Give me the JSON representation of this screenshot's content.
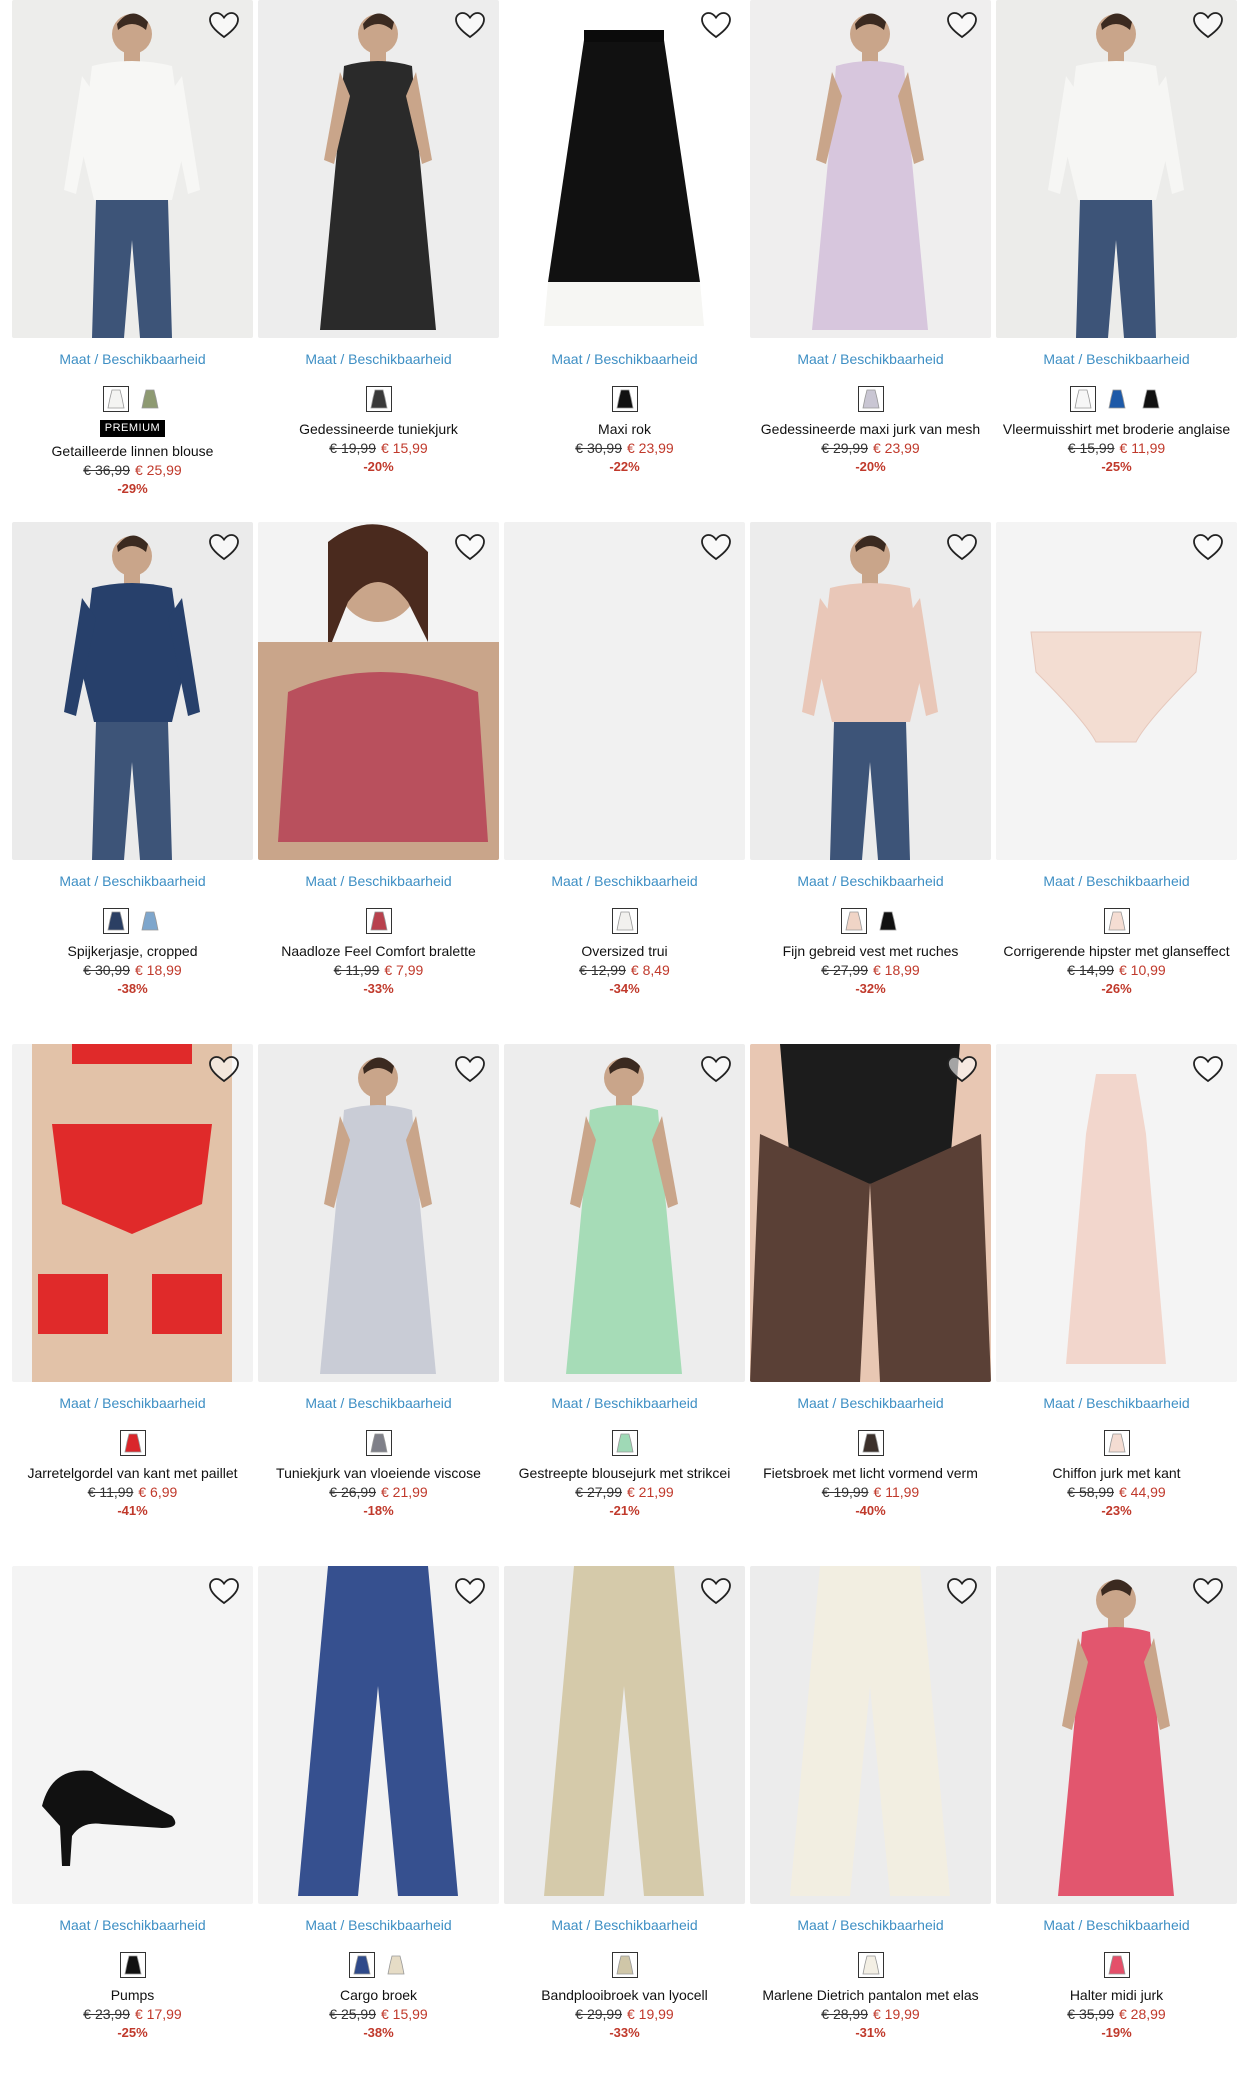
{
  "size_link_label": "Maat / Beschikbaarheid",
  "colors": {
    "link": "#3e8fc4",
    "sale": "#c0392b",
    "badge_bg": "#000000"
  },
  "products": [
    {
      "name": "Getailleerde linnen blouse",
      "old_price": "€ 36,99",
      "new_price": "€ 25,99",
      "discount": "-29%",
      "badge": "PREMIUM",
      "swatches": [
        "#f4f4f2",
        "#8e9a72"
      ],
      "bg": "#ededeb",
      "garment": "#f7f7f5",
      "kind": "top-person"
    },
    {
      "name": "Gedessineerde tuniekjurk",
      "old_price": "€ 19,99",
      "new_price": "€ 15,99",
      "discount": "-20%",
      "badge": "",
      "swatches": [
        "#3a3a3a"
      ],
      "bg": "#ededed",
      "garment": "#2a2a2a",
      "kind": "dress-person"
    },
    {
      "name": "Maxi rok",
      "old_price": "€ 30,99",
      "new_price": "€ 23,99",
      "discount": "-22%",
      "badge": "",
      "swatches": [
        "#111111"
      ],
      "bg": "#ffffff",
      "garment": "#111111",
      "kind": "skirt"
    },
    {
      "name": "Gedessineerde maxi jurk van mesh",
      "old_price": "€ 29,99",
      "new_price": "€ 23,99",
      "discount": "-20%",
      "badge": "",
      "swatches": [
        "#c9c6d3"
      ],
      "bg": "#efeeee",
      "garment": "#d7c6dd",
      "kind": "dress-person"
    },
    {
      "name": "Vleermuisshirt met broderie anglaise",
      "old_price": "€ 15,99",
      "new_price": "€ 11,99",
      "discount": "-25%",
      "badge": "",
      "swatches": [
        "#f7f7f7",
        "#1e5aa8",
        "#111111"
      ],
      "bg": "#ececea",
      "garment": "#f6f6f4",
      "kind": "top-person"
    },
    {
      "name": "Spijkerjasje, cropped",
      "old_price": "€ 30,99",
      "new_price": "€ 18,99",
      "discount": "-38%",
      "badge": "",
      "swatches": [
        "#2b3f63",
        "#7ea6cc"
      ],
      "bg": "#ebebeb",
      "garment": "#27406b",
      "kind": "top-person"
    },
    {
      "name": "Naadloze Feel Comfort bralette",
      "old_price": "€ 11,99",
      "new_price": "€ 7,99",
      "discount": "-33%",
      "badge": "",
      "swatches": [
        "#b8414d"
      ],
      "bg": "#f3f3f3",
      "garment": "#b9505d",
      "kind": "bra"
    },
    {
      "name": "Oversized trui",
      "old_price": "€ 12,99",
      "new_price": "€ 8,49",
      "discount": "-34%",
      "badge": "",
      "swatches": [
        "#f2f1ee"
      ],
      "bg": "#f1f1f1",
      "garment": "#f1f1f1",
      "kind": "none"
    },
    {
      "name": "Fijn gebreid vest met ruches",
      "old_price": "€ 27,99",
      "new_price": "€ 18,99",
      "discount": "-32%",
      "badge": "",
      "swatches": [
        "#f0d4c6",
        "#111111"
      ],
      "bg": "#ececec",
      "garment": "#e9c7b8",
      "kind": "top-person"
    },
    {
      "name": "Corrigerende hipster met glanseffect",
      "old_price": "€ 14,99",
      "new_price": "€ 10,99",
      "discount": "-26%",
      "badge": "",
      "swatches": [
        "#f5ddd3"
      ],
      "bg": "#f4f4f4",
      "garment": "#f3ddd2",
      "kind": "brief"
    },
    {
      "name": "Jarretelgordel van kant met paillet",
      "old_price": "€ 11,99",
      "new_price": "€ 6,99",
      "discount": "-41%",
      "badge": "",
      "swatches": [
        "#d9262b"
      ],
      "bg": "#f2f2f2",
      "garment": "#e02a2a",
      "kind": "lingerie"
    },
    {
      "name": "Tuniekjurk van vloeiende viscose",
      "old_price": "€ 26,99",
      "new_price": "€ 21,99",
      "discount": "-18%",
      "badge": "",
      "swatches": [
        "#7f8089"
      ],
      "bg": "#ededed",
      "garment": "#c9ccd6",
      "kind": "dress-person"
    },
    {
      "name": "Gestreepte blousejurk met strikcei",
      "old_price": "€ 27,99",
      "new_price": "€ 21,99",
      "discount": "-21%",
      "badge": "",
      "swatches": [
        "#9fd9b6"
      ],
      "bg": "#ededed",
      "garment": "#a6dcb7",
      "kind": "dress-person"
    },
    {
      "name": "Fietsbroek met licht vormend verm",
      "old_price": "€ 19,99",
      "new_price": "€ 11,99",
      "discount": "-40%",
      "badge": "",
      "swatches": [
        "#3b302b"
      ],
      "bg": "#efefef",
      "garment": "#1c1c1c",
      "kind": "shorts"
    },
    {
      "name": "Chiffon jurk met kant",
      "old_price": "€ 58,99",
      "new_price": "€ 44,99",
      "discount": "-23%",
      "badge": "",
      "swatches": [
        "#f4dcd2"
      ],
      "bg": "#f4f4f4",
      "garment": "#f2d6cc",
      "kind": "gown"
    },
    {
      "name": "Pumps",
      "old_price": "€ 23,99",
      "new_price": "€ 17,99",
      "discount": "-25%",
      "badge": "",
      "swatches": [
        "#111111"
      ],
      "bg": "#f4f4f4",
      "garment": "#111111",
      "kind": "shoe"
    },
    {
      "name": "Cargo broek",
      "old_price": "€ 25,99",
      "new_price": "€ 15,99",
      "discount": "-38%",
      "badge": "",
      "swatches": [
        "#2f4a8a",
        "#e6dcc6"
      ],
      "bg": "#f2f2f2",
      "garment": "#36508f",
      "kind": "pants"
    },
    {
      "name": "Bandplooibroek van lyocell",
      "old_price": "€ 29,99",
      "new_price": "€ 19,99",
      "discount": "-33%",
      "badge": "",
      "swatches": [
        "#cfc6a8"
      ],
      "bg": "#ececec",
      "garment": "#d5caaa",
      "kind": "pants"
    },
    {
      "name": "Marlene Dietrich pantalon met elas",
      "old_price": "€ 28,99",
      "new_price": "€ 19,99",
      "discount": "-31%",
      "badge": "",
      "swatches": [
        "#f3efe4"
      ],
      "bg": "#ececec",
      "garment": "#f2eee1",
      "kind": "pants"
    },
    {
      "name": "Halter midi jurk",
      "old_price": "€ 35,99",
      "new_price": "€ 28,99",
      "discount": "-19%",
      "badge": "",
      "swatches": [
        "#e4506a"
      ],
      "bg": "#ededed",
      "garment": "#e2566e",
      "kind": "dress-person"
    }
  ]
}
